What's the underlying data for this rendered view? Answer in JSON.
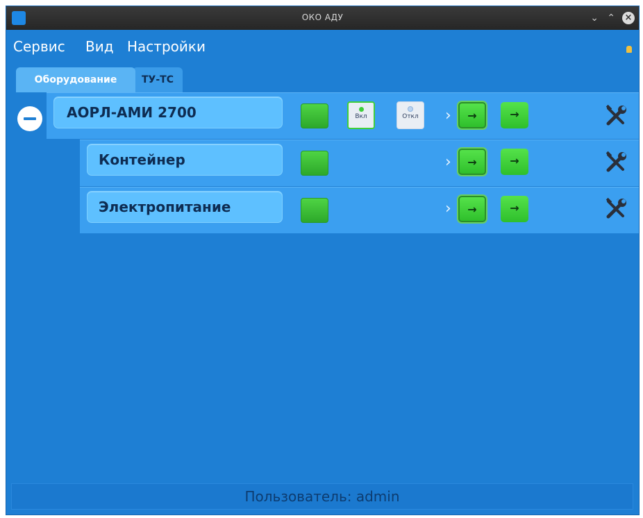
{
  "window": {
    "title": "ОКО АДУ",
    "controls": [
      "chevron-down-icon",
      "chevron-up-icon",
      "close-icon"
    ]
  },
  "menu": {
    "service": "Сервис",
    "view": "Вид",
    "settings": "Настройки"
  },
  "tabs": {
    "equipment": "Оборудование",
    "tu_ts": "ТУ-ТС"
  },
  "devices": [
    {
      "name": "АОРЛ-АМИ 2700",
      "status": "ok",
      "on_label": "Вкл",
      "off_label": "Откл"
    },
    {
      "name": "Контейнер",
      "status": "ok"
    },
    {
      "name": "Электропитание",
      "status": "ok"
    }
  ],
  "colors": {
    "window_bg": "#1e7fd4",
    "row_bg": "#3b9ff0",
    "ok_green": "#3fcf3a"
  },
  "status_bar": {
    "text": "Пользователь: admin"
  }
}
